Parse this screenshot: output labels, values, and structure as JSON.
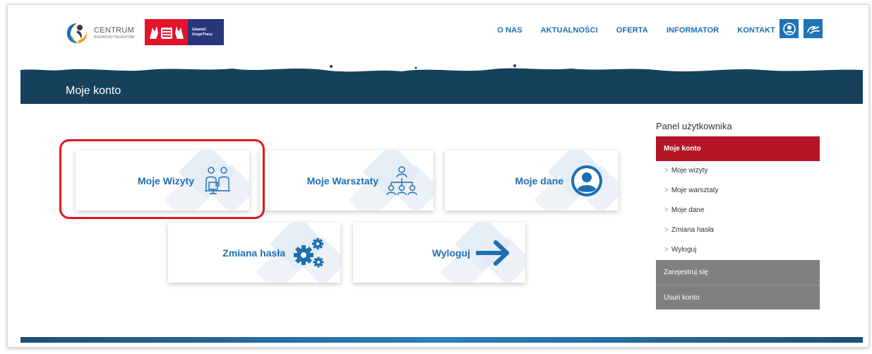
{
  "header": {
    "logo_main": "CENTRUM",
    "logo_sub": "ROZWOJU TALENTÓW",
    "logo_partner_line1": "Gdański",
    "logo_partner_line2": "Urząd Pracy",
    "nav": [
      "O NAS",
      "AKTUALNOŚCI",
      "OFERTA",
      "INFORMATOR",
      "KONTAKT"
    ],
    "icons": [
      "user-icon",
      "sign-language-icon"
    ]
  },
  "banner": {
    "title": "Moje konto"
  },
  "tiles": [
    {
      "label": "Moje Wizyty",
      "icon": "meeting-icon"
    },
    {
      "label": "Moje Warsztaty",
      "icon": "workshop-icon"
    },
    {
      "label": "Moje dane",
      "icon": "user-circle-icon"
    },
    {
      "label": "Zmiana hasła",
      "icon": "gears-icon"
    },
    {
      "label": "Wyloguj",
      "icon": "arrow-right-icon"
    }
  ],
  "sidebar": {
    "title": "Panel użytkownika",
    "active": "Moje konto",
    "subitems": [
      "Moje wizyty",
      "Moje warsztaty",
      "Moje dane",
      "Zmiana hasła",
      "Wyloguj"
    ],
    "register": "Zarejestruj się",
    "delete": "Usuń konto"
  },
  "colors": {
    "accent": "#1d6fb2",
    "banner": "#16415c",
    "sidebar_active": "#b41626",
    "sidebar_gray": "#808080",
    "highlight": "#e5141e"
  }
}
